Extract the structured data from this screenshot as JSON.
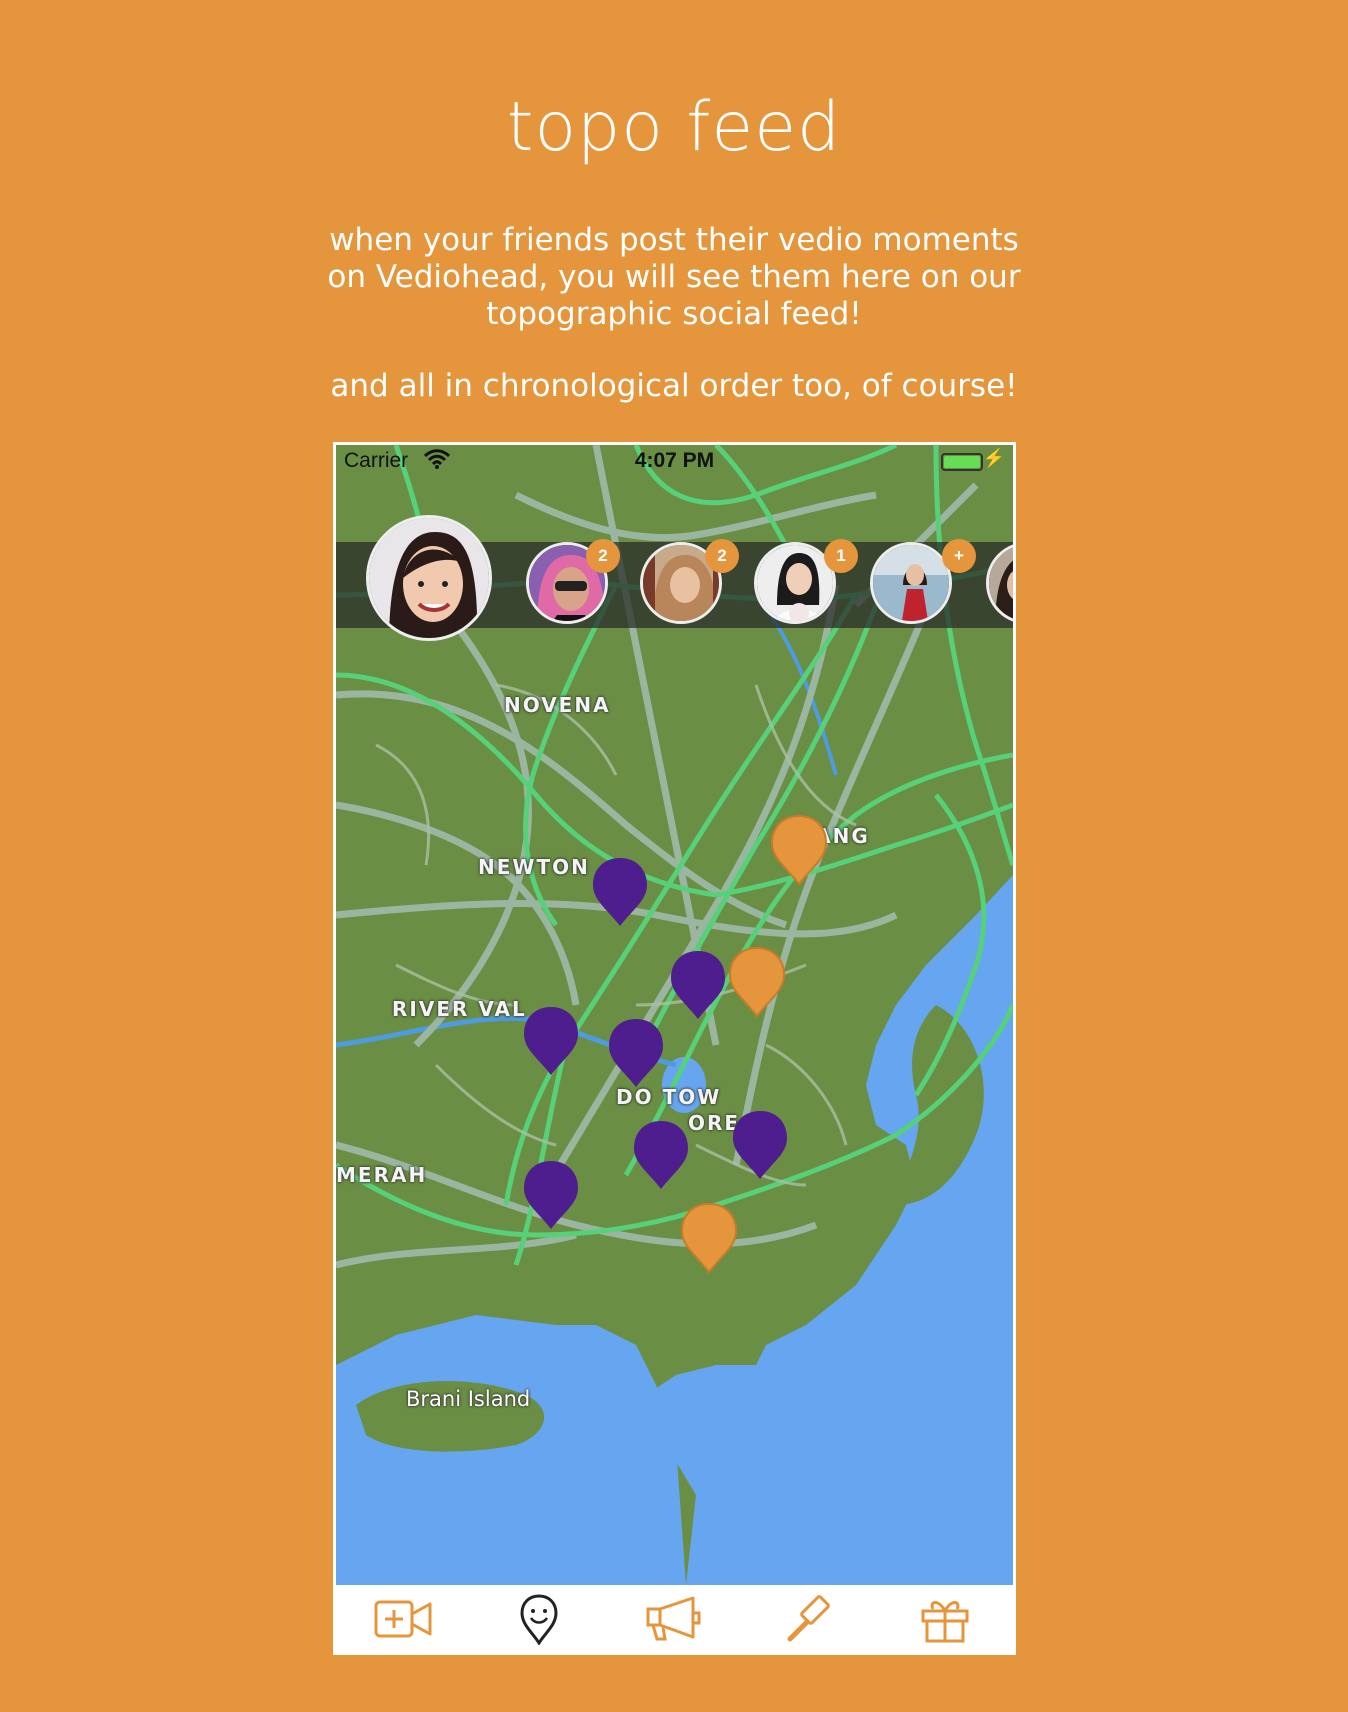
{
  "header": {
    "title": "topo feed",
    "desc_line1": "when your friends post their vedio moments",
    "desc_line2": "on Vediohead, you will see them here on our",
    "desc_line3": "topographic social feed!",
    "desc_extra": "and all in chronological order too, of course!"
  },
  "status_bar": {
    "carrier": "Carrier",
    "time": "4:07 PM"
  },
  "stories": {
    "items": [
      {
        "badge": "2"
      },
      {
        "badge": "2"
      },
      {
        "badge": "1"
      },
      {
        "badge": "+"
      }
    ]
  },
  "map": {
    "labels": {
      "novena": "NOVENA",
      "newton": "NEWTON",
      "river_valley": "RIVER VAL",
      "kallang": "K      LANG",
      "downtown1": "DO      TOW",
      "downtown2": "ORE",
      "merah": "MERAH",
      "brani": "Brani Island"
    },
    "pin_colors": {
      "friend": "#4E1E8F",
      "own": "#E5953C"
    }
  },
  "colors": {
    "accent": "#E5953C",
    "map_land": "#6A8F44",
    "water": "#66A6F0",
    "road": "#9BB6A0"
  },
  "tabbar": {
    "icons": [
      "video-add-icon",
      "map-pin-smile-icon",
      "megaphone-icon",
      "gavel-icon",
      "gift-icon"
    ]
  }
}
